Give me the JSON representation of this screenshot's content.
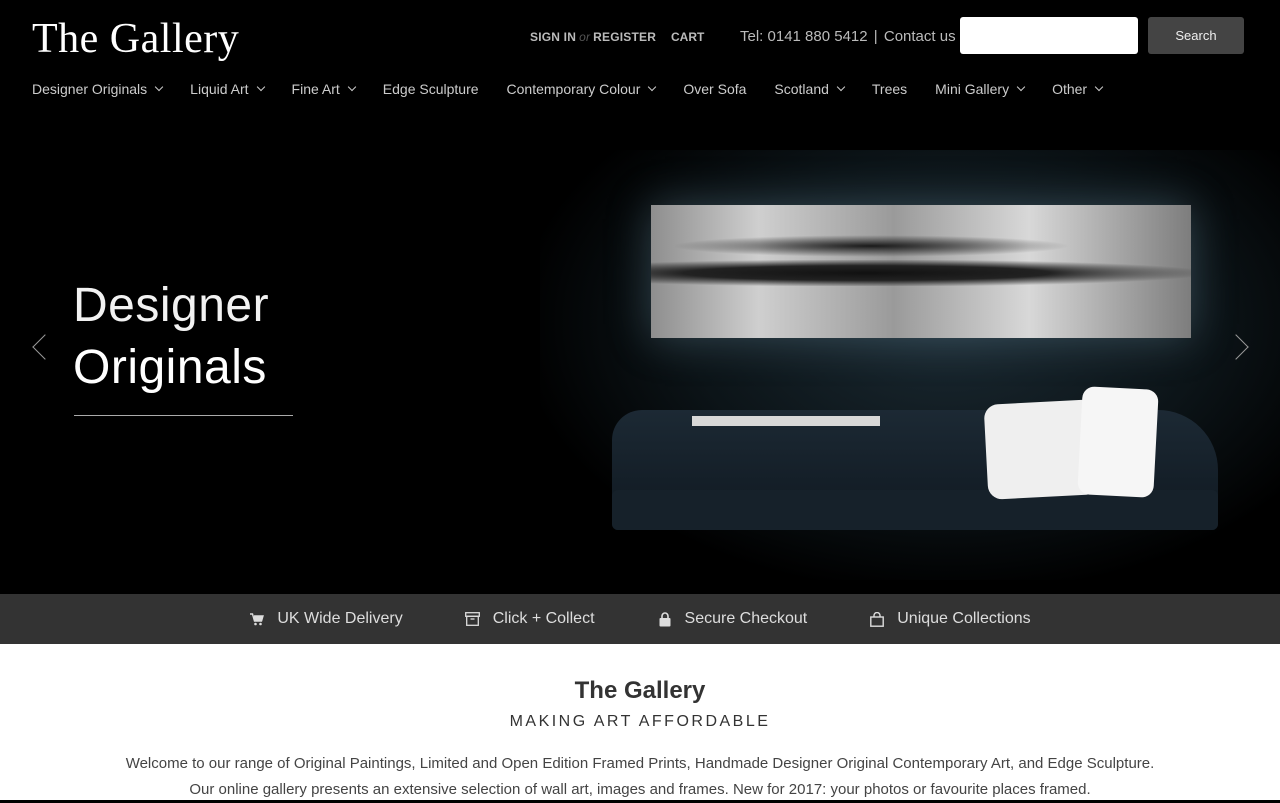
{
  "header": {
    "logo": "The Gallery",
    "sign_in": "SIGN IN",
    "or": "or",
    "register": "REGISTER",
    "cart": "CART",
    "tel": "Tel: 0141 880 5412",
    "separator": "|",
    "contact": "Contact us",
    "search_placeholder": "",
    "search_button": "Search"
  },
  "nav": [
    {
      "label": "Designer Originals",
      "dropdown": true
    },
    {
      "label": "Liquid Art",
      "dropdown": true
    },
    {
      "label": "Fine Art",
      "dropdown": true
    },
    {
      "label": "Edge Sculpture",
      "dropdown": false
    },
    {
      "label": "Contemporary Colour",
      "dropdown": true
    },
    {
      "label": "Over Sofa",
      "dropdown": false
    },
    {
      "label": "Scotland",
      "dropdown": true
    },
    {
      "label": "Trees",
      "dropdown": false
    },
    {
      "label": "Mini Gallery",
      "dropdown": true
    },
    {
      "label": "Other",
      "dropdown": true
    }
  ],
  "hero": {
    "title_line1": "Designer",
    "title_line2": "Originals"
  },
  "features": [
    {
      "icon": "cart-icon",
      "label": "UK Wide Delivery"
    },
    {
      "icon": "archive-box-icon",
      "label": "Click + Collect"
    },
    {
      "icon": "lock-icon",
      "label": "Secure Checkout"
    },
    {
      "icon": "shopping-bag-icon",
      "label": "Unique Collections"
    }
  ],
  "intro": {
    "title": "The Gallery",
    "subtitle": "MAKING ART AFFORDABLE",
    "line1": "Welcome to our range of Original Paintings, Limited and Open Edition Framed Prints, Handmade Designer Original Contemporary Art, and Edge Sculpture.",
    "line2": "Our online gallery presents an extensive selection of wall art, images and frames. New for 2017: your photos or favourite places framed."
  },
  "colors": {
    "background": "#000000",
    "features_bar": "#333333",
    "search_button": "#444444"
  }
}
